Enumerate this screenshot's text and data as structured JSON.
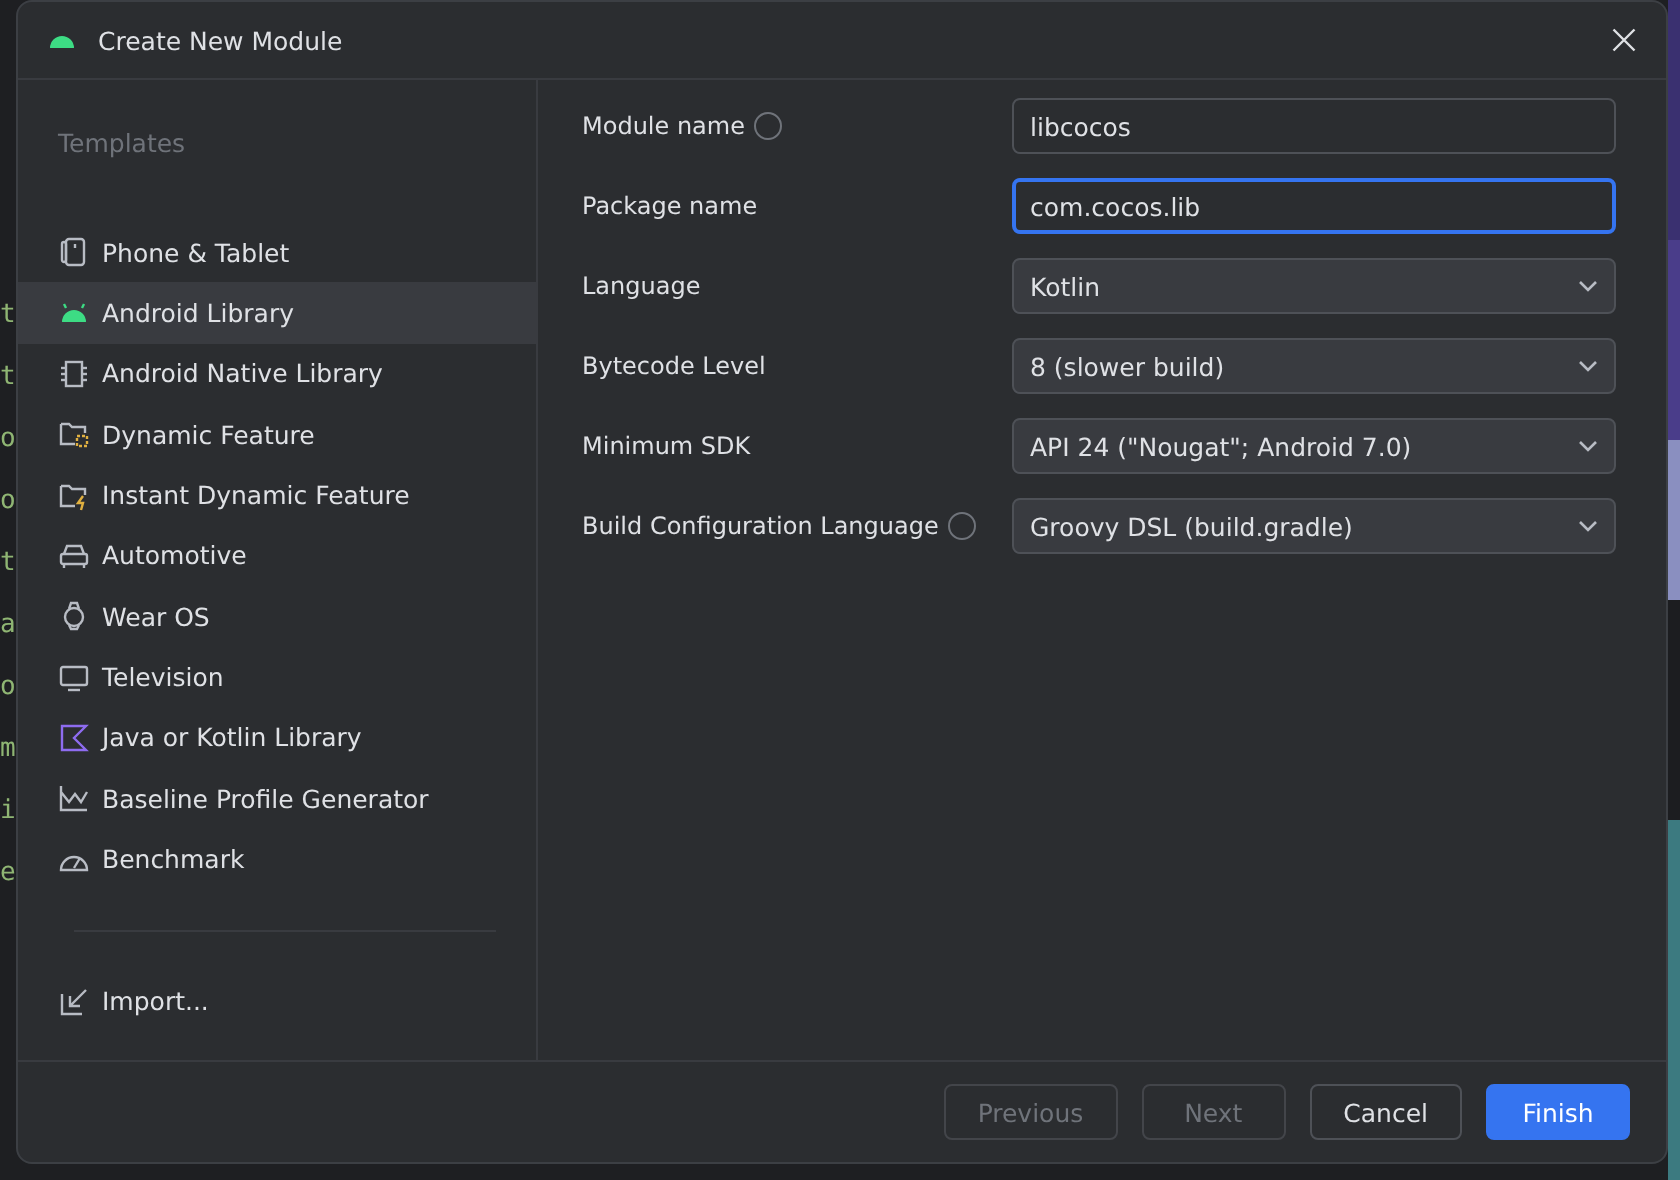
{
  "editor_fragments": [
    "t",
    "t",
    "o",
    "o",
    "t",
    "a",
    "o",
    "m",
    "i",
    "e"
  ],
  "window": {
    "title": "Create New Module"
  },
  "sidebar": {
    "heading": "Templates",
    "items": [
      {
        "label": "Phone & Tablet",
        "kind": "phone",
        "selected": false
      },
      {
        "label": "Android Library",
        "kind": "android",
        "selected": true
      },
      {
        "label": "Android Native Library",
        "kind": "chip",
        "selected": false
      },
      {
        "label": "Dynamic Feature",
        "kind": "folder",
        "selected": false
      },
      {
        "label": "Instant Dynamic Feature",
        "kind": "folder-bolt",
        "selected": false
      },
      {
        "label": "Automotive",
        "kind": "car",
        "selected": false
      },
      {
        "label": "Wear OS",
        "kind": "watch",
        "selected": false
      },
      {
        "label": "Television",
        "kind": "tv",
        "selected": false
      },
      {
        "label": "Java or Kotlin Library",
        "kind": "kotlin",
        "selected": false
      },
      {
        "label": "Baseline Profile Generator",
        "kind": "chart",
        "selected": false
      },
      {
        "label": "Benchmark",
        "kind": "gauge",
        "selected": false
      }
    ],
    "footer_item": {
      "label": "Import...",
      "kind": "import"
    }
  },
  "form": [
    {
      "label": "Module name",
      "help": true,
      "kind": "text",
      "value": "libcocos",
      "focused": false
    },
    {
      "label": "Package name",
      "help": false,
      "kind": "text",
      "value": "com.cocos.lib",
      "focused": true
    },
    {
      "label": "Language",
      "help": false,
      "kind": "select",
      "value": "Kotlin",
      "focused": false
    },
    {
      "label": "Bytecode Level",
      "help": false,
      "kind": "select",
      "value": "8 (slower build)",
      "focused": false
    },
    {
      "label": "Minimum SDK",
      "help": false,
      "kind": "select",
      "value": "API 24 (\"Nougat\"; Android 7.0)",
      "focused": false
    },
    {
      "label": "Build Configuration Language",
      "help": true,
      "kind": "select",
      "value": "Groovy DSL (build.gradle)",
      "focused": false
    }
  ],
  "buttons": [
    {
      "label": "Previous",
      "disabled": true,
      "primary": false
    },
    {
      "label": "Next",
      "disabled": true,
      "primary": false
    },
    {
      "label": "Cancel",
      "disabled": false,
      "primary": false
    },
    {
      "label": "Finish",
      "disabled": false,
      "primary": true
    }
  ]
}
